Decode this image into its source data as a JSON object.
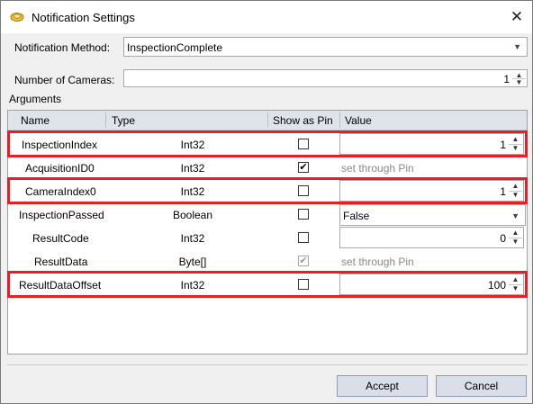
{
  "window": {
    "title": "Notification Settings"
  },
  "fields": {
    "method_label": "Notification Method:",
    "method_value": "InspectionComplete",
    "cameras_label": "Number of Cameras:",
    "cameras_value": "1"
  },
  "arguments_label": "Arguments",
  "grid": {
    "headers": [
      "Name",
      "Type",
      "Show as Pin",
      "Value"
    ],
    "rows": [
      {
        "name": "InspectionIndex",
        "type": "Int32",
        "show_as_pin": false,
        "value": "1",
        "value_kind": "spin",
        "highlighted": true
      },
      {
        "name": "AcquisitionID0",
        "type": "Int32",
        "show_as_pin": true,
        "value": "set through Pin",
        "value_kind": "pin",
        "highlighted": false
      },
      {
        "name": "CameraIndex0",
        "type": "Int32",
        "show_as_pin": false,
        "value": "1",
        "value_kind": "spin",
        "highlighted": true
      },
      {
        "name": "InspectionPassed",
        "type": "Boolean",
        "show_as_pin": false,
        "value": "False",
        "value_kind": "combo",
        "highlighted": false
      },
      {
        "name": "ResultCode",
        "type": "Int32",
        "show_as_pin": false,
        "value": "0",
        "value_kind": "spin",
        "highlighted": false
      },
      {
        "name": "ResultData",
        "type": "Byte[]",
        "show_as_pin": true,
        "value": "set through Pin",
        "value_kind": "pin_disabled",
        "highlighted": false
      },
      {
        "name": "ResultDataOffset",
        "type": "Int32",
        "show_as_pin": false,
        "value": "100",
        "value_kind": "spin",
        "highlighted": true
      }
    ]
  },
  "buttons": {
    "accept": "Accept",
    "cancel": "Cancel"
  },
  "colors": {
    "highlight": "#e41f26",
    "header_bg": "#dfe3ea",
    "button_bg": "#d9dee8"
  },
  "icons": {
    "app": "notification-disc-icon",
    "close": "close-icon",
    "dropdown": "chevron-down-icon",
    "spin_up": "spin-up-icon",
    "spin_down": "spin-down-icon",
    "check": "checkmark-icon"
  }
}
